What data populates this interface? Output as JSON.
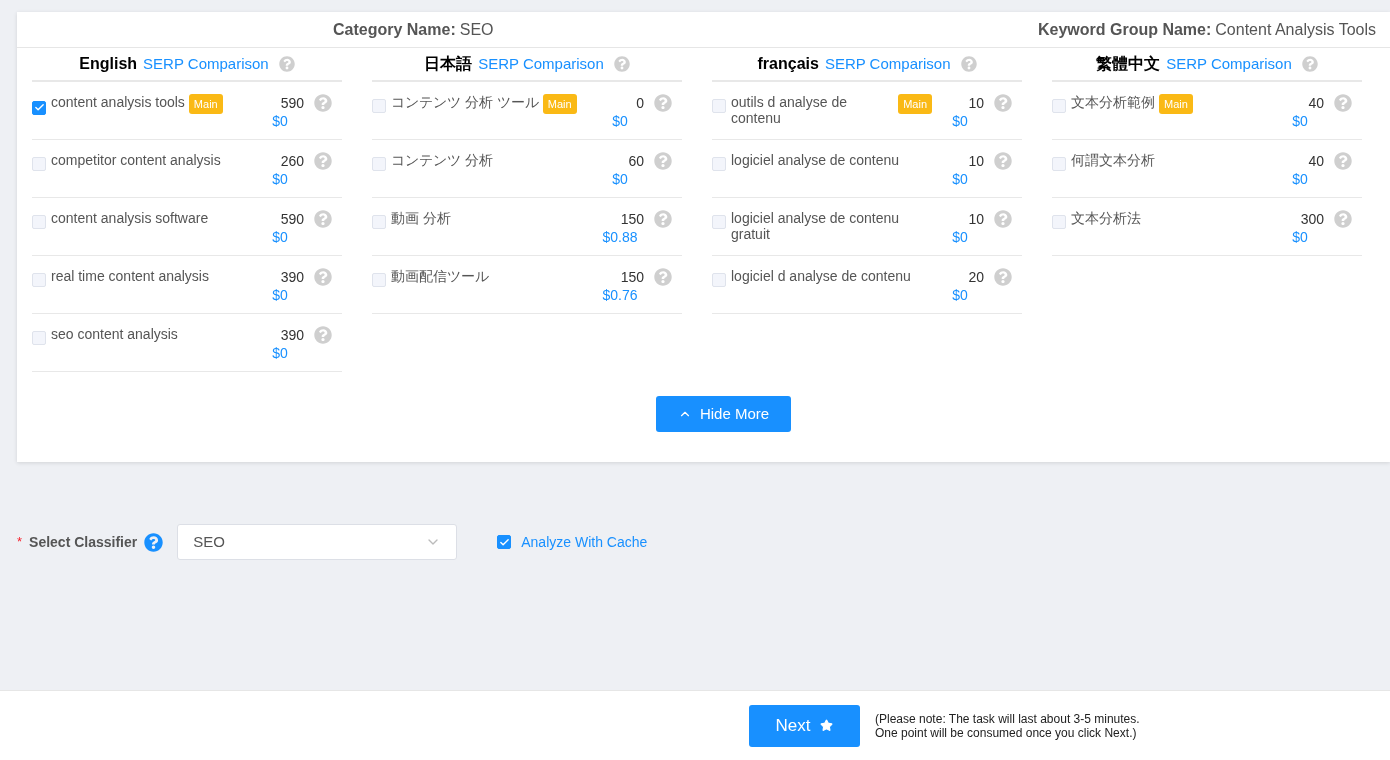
{
  "header": {
    "category_label": "Category Name:",
    "category_value": "SEO",
    "group_label": "Keyword Group Name:",
    "group_value": "Content Analysis Tools"
  },
  "languages": [
    {
      "name": "English",
      "link": "SERP Comparison",
      "keywords": [
        {
          "text": "content analysis tools",
          "badge": "Main",
          "checked": true,
          "volume": "590",
          "cpc": "$0"
        },
        {
          "text": "competitor content analysis",
          "checked": false,
          "volume": "260",
          "cpc": "$0"
        },
        {
          "text": "content analysis software",
          "checked": false,
          "volume": "590",
          "cpc": "$0"
        },
        {
          "text": "real time content analysis",
          "checked": false,
          "volume": "390",
          "cpc": "$0"
        },
        {
          "text": "seo content analysis",
          "checked": false,
          "volume": "390",
          "cpc": "$0"
        }
      ]
    },
    {
      "name": "日本語",
      "link": "SERP Comparison",
      "keywords": [
        {
          "text": "コンテンツ 分析 ツール",
          "badge": "Main",
          "checked": false,
          "volume": "0",
          "cpc": "$0"
        },
        {
          "text": "コンテンツ 分析",
          "checked": false,
          "volume": "60",
          "cpc": "$0"
        },
        {
          "text": "動画 分析",
          "checked": false,
          "volume": "150",
          "cpc": "$0.88"
        },
        {
          "text": "動画配信ツール",
          "checked": false,
          "volume": "150",
          "cpc": "$0.76"
        }
      ]
    },
    {
      "name": "français",
      "link": "SERP Comparison",
      "keywords": [
        {
          "text": "outils d analyse de contenu",
          "badge": "Main",
          "checked": false,
          "volume": "10",
          "cpc": "$0"
        },
        {
          "text": "logiciel analyse de contenu",
          "checked": false,
          "volume": "10",
          "cpc": "$0"
        },
        {
          "text": "logiciel analyse de contenu gratuit",
          "checked": false,
          "volume": "10",
          "cpc": "$0"
        },
        {
          "text": "logiciel d analyse de contenu",
          "checked": false,
          "volume": "20",
          "cpc": "$0"
        }
      ]
    },
    {
      "name": "繁體中文",
      "link": "SERP Comparison",
      "keywords": [
        {
          "text": "文本分析範例",
          "badge": "Main",
          "checked": false,
          "volume": "40",
          "cpc": "$0"
        },
        {
          "text": "何謂文本分析",
          "checked": false,
          "volume": "40",
          "cpc": "$0"
        },
        {
          "text": "文本分析法",
          "checked": false,
          "volume": "300",
          "cpc": "$0"
        }
      ]
    }
  ],
  "hide_more_button": "Hide More",
  "classifier": {
    "required_mark": "*",
    "label": "Select Classifier",
    "value": "SEO"
  },
  "cache_option": {
    "label": "Analyze With Cache",
    "checked": true
  },
  "next_button": "Next",
  "note": [
    "(Please note: The task will last about 3-5 minutes.",
    "One point will be consumed once you click Next.)"
  ]
}
